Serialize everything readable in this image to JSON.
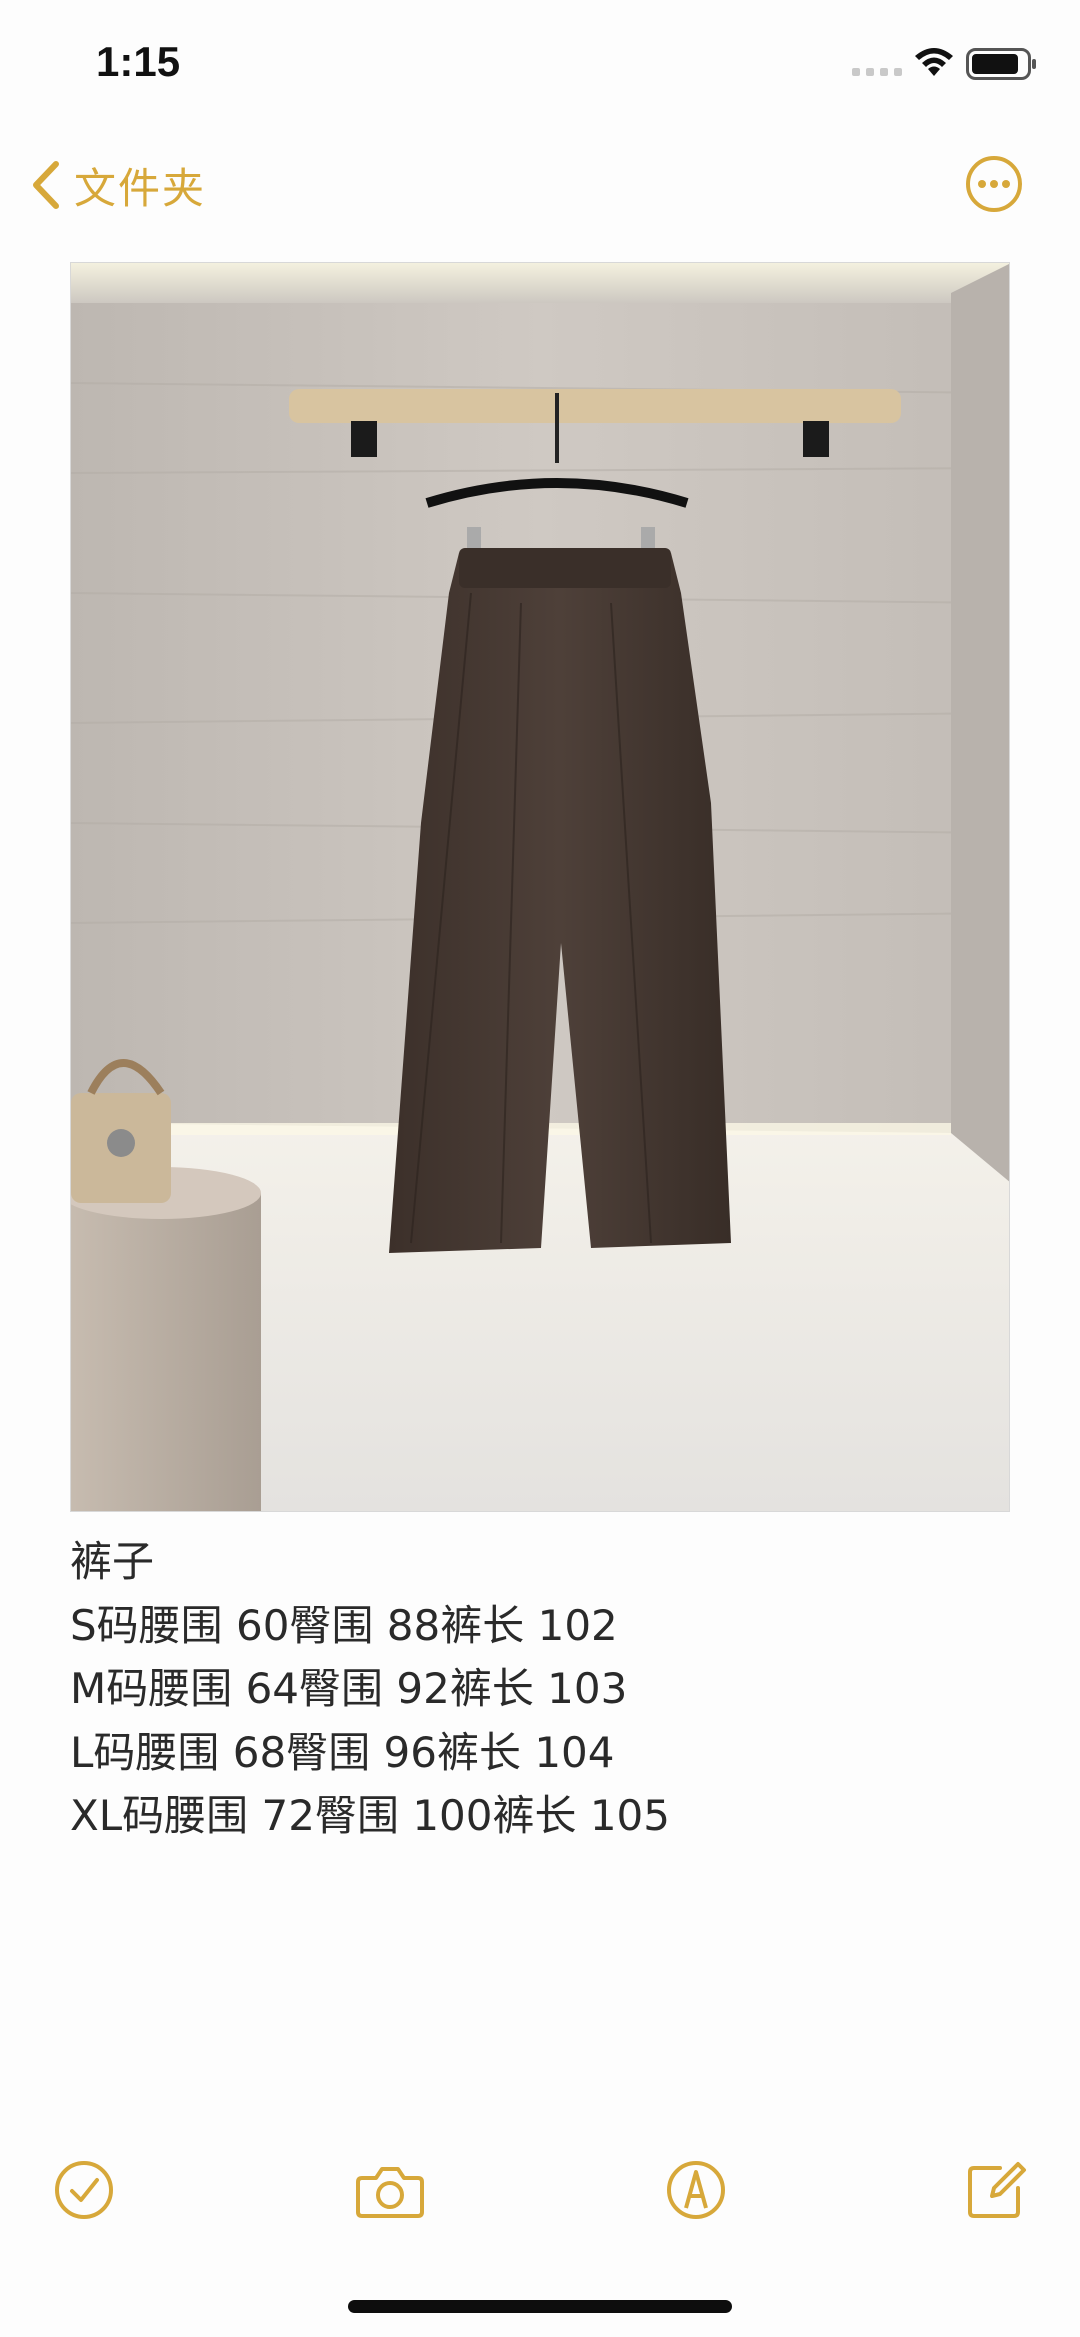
{
  "status_bar": {
    "time": "1:15",
    "icons": [
      "signal-icon",
      "wifi-icon",
      "battery-icon"
    ]
  },
  "nav": {
    "back_label": "文件夹",
    "back_icon": "chevron-left-icon",
    "more_icon": "ellipsis-circle-icon"
  },
  "photo": {
    "description_icon": "image"
  },
  "note": {
    "lines": [
      "裤子",
      "S码腰围 60臀围 88裤长 102",
      "M码腰围 64臀围 92裤长 103",
      "L码腰围 68臀围 96裤长 104",
      "XL码腰围 72臀围 100裤长 105"
    ]
  },
  "toolbar": {
    "items": [
      "checklist-icon",
      "camera-icon",
      "markup-icon",
      "compose-icon"
    ]
  },
  "colors": {
    "accent": "#D7A83A",
    "background": "#FDFDFD",
    "text": "#2A2A2A"
  }
}
